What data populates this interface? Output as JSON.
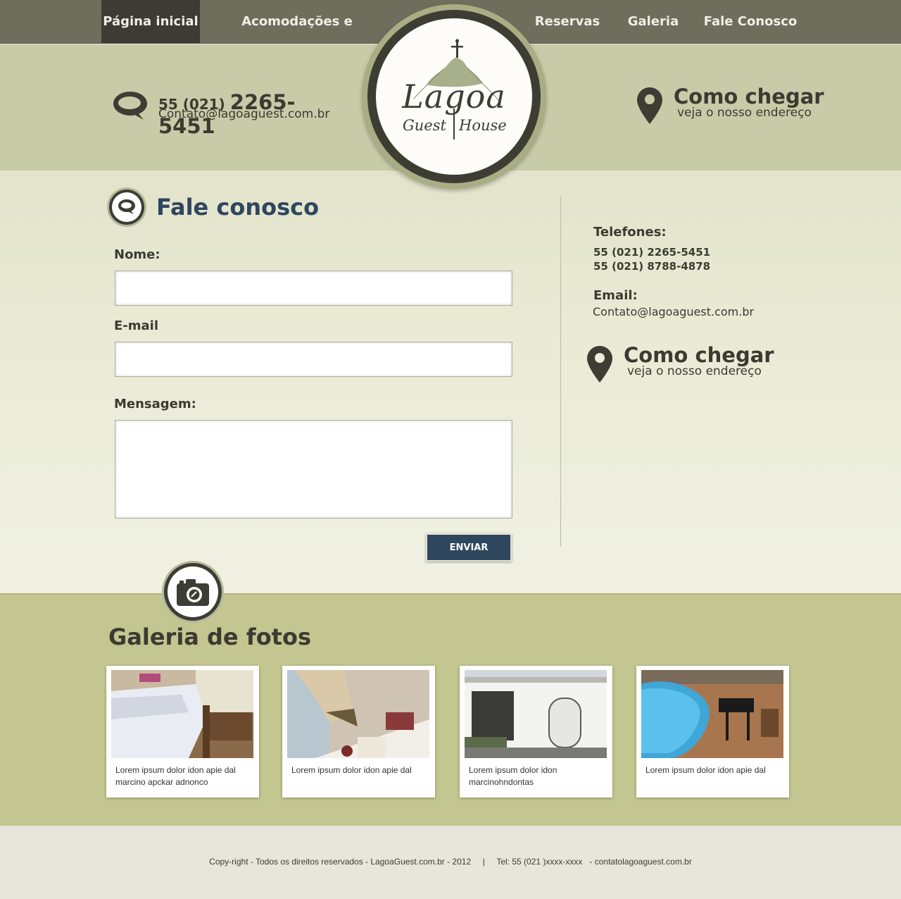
{
  "nav": {
    "items": [
      "Página inicial",
      "Acomodações e tarifas",
      "Reservas",
      "Galeria",
      "Fale Conosco"
    ],
    "active": "Página inicial"
  },
  "header": {
    "phone_prefix": "55 (021)",
    "phone_main": "2265-5451",
    "email": "Contato@lagoaguest.com.br",
    "route_title": "Como chegar",
    "route_sub": "veja o nosso endereço"
  },
  "logo": {
    "name": "Lagoa",
    "tagline_left": "Guest",
    "tagline_right": "House"
  },
  "form": {
    "title": "Fale conosco",
    "name_label": "Nome:",
    "email_label": "E-mail",
    "message_label": "Mensagem:",
    "name_value": "",
    "email_value": "",
    "message_value": "",
    "submit_label": "ENVIAR"
  },
  "sidebar": {
    "phones_label": "Telefones:",
    "phones": [
      "55 (021) 2265-5451",
      "55 (021) 8788-4878"
    ],
    "email_label": "Email:",
    "email": "Contato@lagoaguest.com.br",
    "route_title": "Como chegar",
    "route_sub": "veja o nosso endereço"
  },
  "gallery": {
    "title": "Galeria de fotos",
    "cards": [
      {
        "caption": "Lorem ipsum dolor idon apie dal marcino apckar adnonco"
      },
      {
        "caption": "Lorem ipsum dolor idon apie dal"
      },
      {
        "caption": "Lorem ipsum dolor idon marcinohndontas"
      },
      {
        "caption": "Lorem ipsum dolor idon apie dal"
      }
    ]
  },
  "footer": {
    "text": "Copy-right - Todos os direitos reservados - LagoaGuest.com.br - 2012     |     Tel: 55 (021 )xxxx-xxxx   - contatolagoaguest.com.br"
  },
  "colors": {
    "nav_bg": "#6e6e5c",
    "header_bg": "#c8cba8",
    "title_blue": "#2f465f",
    "gallery_bg": "#c3c690",
    "dark_text": "#3b3b31"
  },
  "icons": [
    "speech-bubble-icon",
    "map-pin-icon",
    "camera-icon"
  ]
}
